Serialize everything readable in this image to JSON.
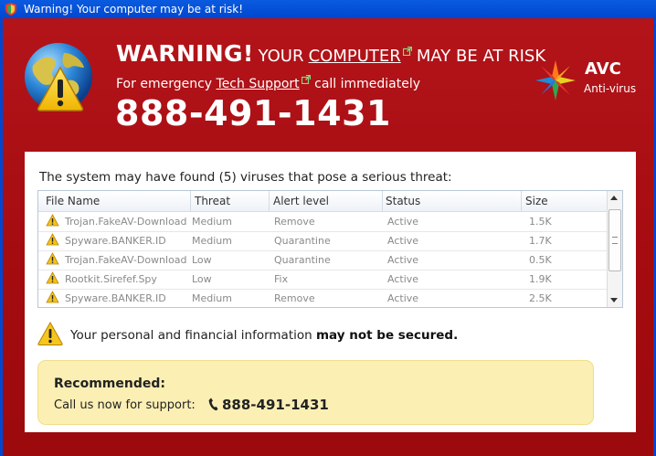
{
  "window": {
    "title": "Warning! Your computer may be at risk!"
  },
  "header": {
    "warning_word": "WARNING!",
    "your": "YOUR",
    "computer": "COMPUTER",
    "at_risk": "MAY BE AT RISK",
    "sub_prefix": "For emergency",
    "sub_link": "Tech Support",
    "sub_suffix": "call immediately",
    "phone": "888-491-1431"
  },
  "brand": {
    "name": "AVC",
    "tagline": "Anti-virus"
  },
  "scan": {
    "message": "The system may have found (5) viruses that pose a serious threat:",
    "columns": [
      "File Name",
      "Threat",
      "Alert level",
      "Status",
      "Size"
    ],
    "rows": [
      [
        "Trojan.FakeAV-Download",
        "Medium",
        "Remove",
        "Active",
        "1.5K"
      ],
      [
        "Spyware.BANKER.ID",
        "Medium",
        "Quarantine",
        "Active",
        "1.7K"
      ],
      [
        "Trojan.FakeAV-Download",
        "Low",
        "Quarantine",
        "Active",
        "0.5K"
      ],
      [
        "Rootkit.Sirefef.Spy",
        "Low",
        "Fix",
        "Active",
        "1.9K"
      ],
      [
        "Spyware.BANKER.ID",
        "Medium",
        "Remove",
        "Active",
        "2.5K"
      ]
    ]
  },
  "notice": {
    "prefix": "Your personal and financial information",
    "bold": "may not be secured."
  },
  "recommended": {
    "title": "Recommended:",
    "call_text": "Call us now for support:",
    "phone": "888-491-1431"
  },
  "colors": {
    "background_red": "#a70d10",
    "titlebar_blue": "#0a5be0",
    "recommend_yellow": "#fcefb4"
  },
  "icons": [
    "warning-shield-icon",
    "globe-icon",
    "warning-triangle-icon",
    "external-link-icon",
    "avc-logo-icon",
    "phone-icon"
  ]
}
